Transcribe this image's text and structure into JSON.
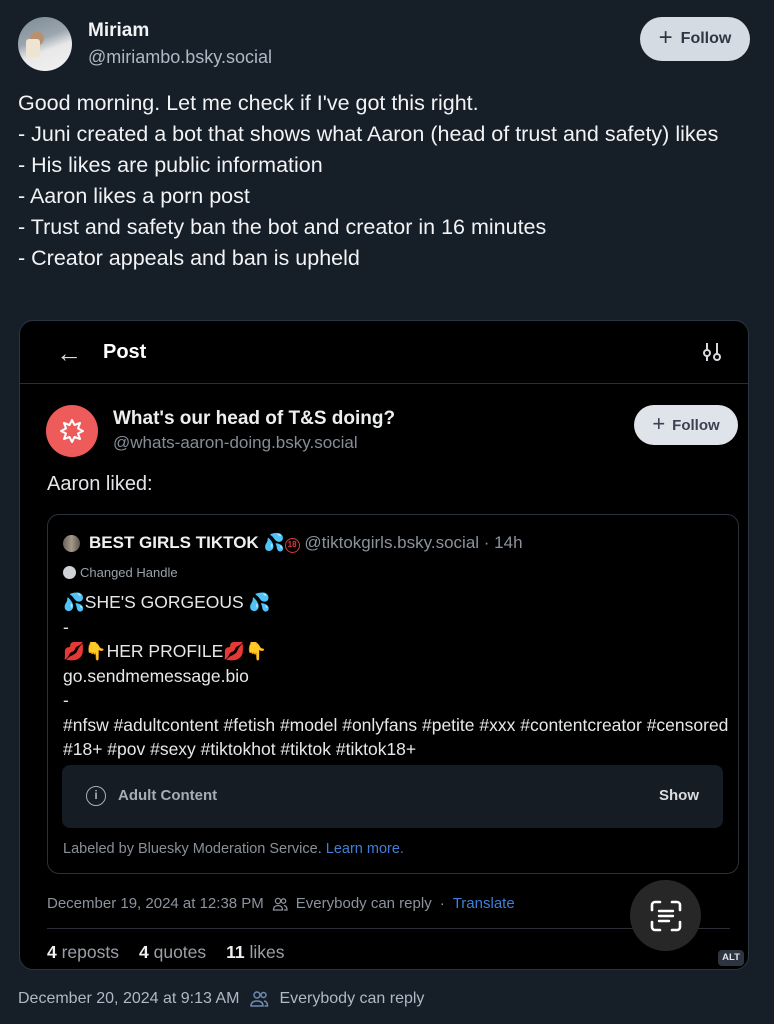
{
  "author": {
    "display_name": "Miriam",
    "handle": "@miriambo.bsky.social",
    "follow_label": "Follow"
  },
  "post": {
    "lines": [
      "Good morning. Let me check if I've got this right.",
      "- Juni created a bot that shows what Aaron (head of trust and safety) likes",
      "- His likes are public information",
      "- Aaron likes a porn post",
      "- Trust and safety ban the bot and creator in 16 minutes",
      "- Creator appeals and ban is upheld"
    ],
    "timestamp": "December 20, 2024 at 9:13 AM",
    "reply_setting": "Everybody can reply"
  },
  "screenshot": {
    "back_icon": "arrow-left-icon",
    "title": "Post",
    "settings_icon": "sliders-icon",
    "bot": {
      "name": "What's our head of T&S doing?",
      "handle": "@whats-aaron-doing.bsky.social",
      "follow_label": "Follow"
    },
    "intro": "Aaron liked:",
    "quoted": {
      "name": "BEST GIRLS TIKTOK",
      "name_emoji": "💦",
      "badge": "18",
      "handle": "@tiktokgirls.bsky.social",
      "age": "· 14h",
      "changed_handle": "Changed Handle",
      "body": {
        "line1_emoji": "💦",
        "line1": "SHE'S GORGEOUS ",
        "line1_emoji_end": "💦",
        "sep1": "-",
        "line3_emoji": "💋👇",
        "line3": "HER PROFILE",
        "line3_emoji_end": "💋👇",
        "link": "go.sendmemessage.bio",
        "sep2": "-",
        "hashtags": "#nfsw #adultcontent #fetish #model #onlyfans #petite #xxx #contentcreator #censored #18+ #pov #sexy #tiktokhot #tiktok #tiktok18+"
      },
      "warning_label": "Adult Content",
      "show_label": "Show",
      "labeled_by": "Labeled by Bluesky Moderation Service.",
      "learn_more": "Learn more."
    },
    "timestamp": "December 19, 2024 at 12:38 PM",
    "reply_setting": "Everybody can reply",
    "separator": "·",
    "translate": "Translate",
    "stats": {
      "reposts_count": "4",
      "reposts_label": "reposts",
      "quotes_count": "4",
      "quotes_label": "quotes",
      "likes_count": "11",
      "likes_label": "likes"
    },
    "alt_badge": "ALT"
  }
}
